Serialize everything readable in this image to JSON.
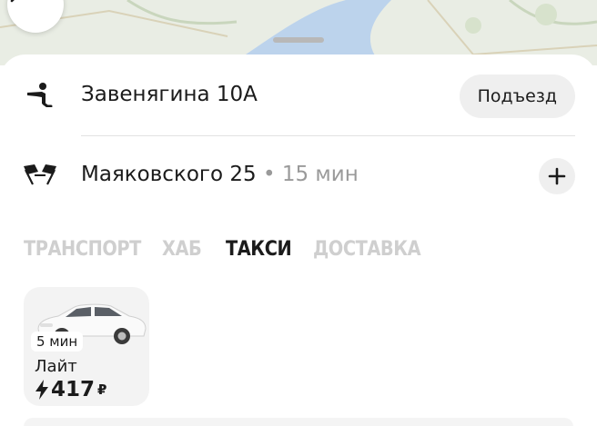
{
  "map": {
    "icons": {
      "back": "chevron-left-icon"
    }
  },
  "route": {
    "from": {
      "address": "Завенягина 10А",
      "icon": "pickup-person-icon",
      "entrance_label": "Подъезд"
    },
    "to": {
      "address": "Маяковского 25",
      "eta": "• 15 мин",
      "icon": "finish-flags-icon",
      "add_icon": "plus-icon"
    }
  },
  "tabs": [
    {
      "label": "ТРАНСПОРТ",
      "active": false
    },
    {
      "label": "ХАБ",
      "active": false
    },
    {
      "label": "ТАКСИ",
      "active": true
    },
    {
      "label": "ДОСТАВКА",
      "active": false
    }
  ],
  "tariffs": [
    {
      "eta": "5 мин",
      "name": "Лайт",
      "price": "417",
      "currency": "₽",
      "icon": "car-icon",
      "price_icon": "bolt-icon"
    }
  ],
  "colors": {
    "accent_text": "#1b1b1b",
    "inactive_tab": "#cfcfcf",
    "chip_bg": "#efefef",
    "map_bg": "#e9ede4"
  }
}
